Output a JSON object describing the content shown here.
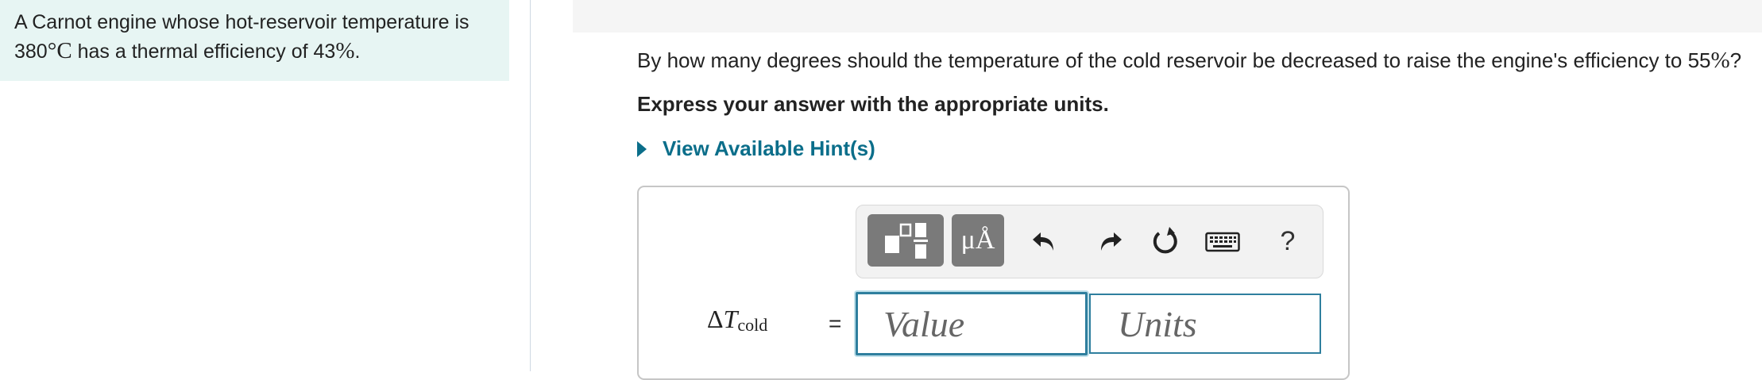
{
  "problem": {
    "line1": "A Carnot engine whose hot-reservoir temperature is",
    "temp": "380",
    "degree": "°",
    "unit_c": "C",
    "mid": " has a thermal efficiency of ",
    "efficiency": "43",
    "percent": "%",
    "end": "."
  },
  "question": {
    "text": "By how many degrees should the temperature of the cold reservoir be decreased to raise the engine's efficiency to ",
    "target": "55",
    "percent": "%",
    "end": "?"
  },
  "instruction": "Express your answer with the appropriate units.",
  "hints": {
    "label": "View Available Hint(s)"
  },
  "toolbar": {
    "units_button_label": "μÅ",
    "help_label": "?"
  },
  "answer": {
    "delta": "Δ",
    "variable": "T",
    "subscript": "cold",
    "equals": "=",
    "value_placeholder": "Value",
    "units_placeholder": "Units"
  },
  "colors": {
    "problem_bg": "#e7f5f3",
    "link": "#0b6e8a",
    "input_border": "#2f7f9e",
    "toolbar_button": "#7a7a7a"
  },
  "icons": [
    "templates-icon",
    "undo-icon",
    "redo-icon",
    "reset-icon",
    "keyboard-icon",
    "help-icon"
  ]
}
